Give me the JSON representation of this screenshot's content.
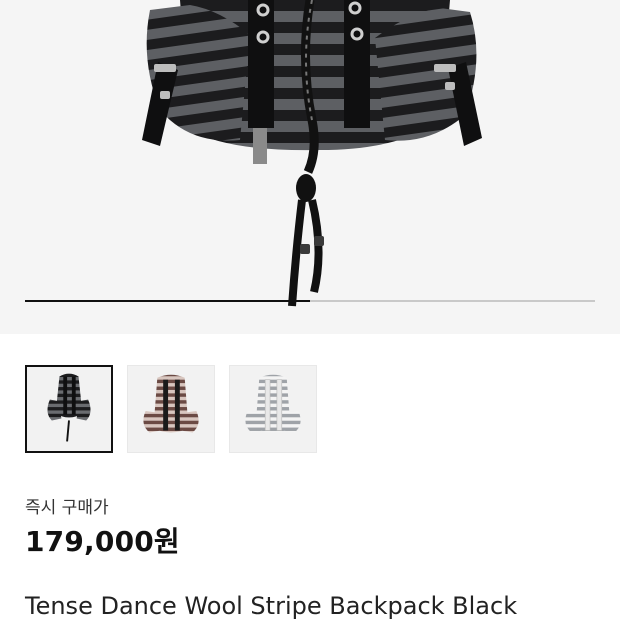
{
  "product": {
    "image_count": 3,
    "selected_index": 0,
    "slide_progress": 0.5,
    "thumbnails": [
      {
        "name": "thumbnail-black",
        "color": "black stripe"
      },
      {
        "name": "thumbnail-brown",
        "color": "brown stripe"
      },
      {
        "name": "thumbnail-white",
        "color": "white stripe"
      }
    ],
    "price_label": "즉시 구매가",
    "price": "179,000원",
    "title": "Tense Dance Wool Stripe Backpack Black"
  },
  "colors": {
    "hero_bg": "#f5f5f5",
    "stripe_dark": "#1c1c1e",
    "stripe_gray": "#5d5f63",
    "progress_fill": "#111111",
    "progress_track": "#c9c9c9"
  }
}
